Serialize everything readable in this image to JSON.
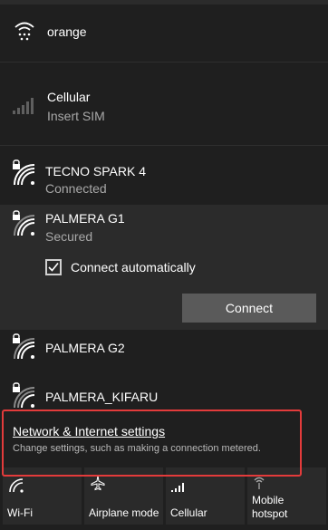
{
  "networks": {
    "top": {
      "name": "orange"
    },
    "cellular": {
      "name": "Cellular",
      "status": "Insert SIM"
    },
    "connected": {
      "name": "TECNO SPARK 4",
      "status": "Connected"
    },
    "selected": {
      "name": "PALMERA G1",
      "status": "Secured",
      "auto_label": "Connect automatically",
      "auto_checked": true,
      "connect_label": "Connect"
    },
    "others": [
      {
        "name": "PALMERA G2"
      },
      {
        "name": "PALMERA_KIFARU"
      }
    ]
  },
  "settings": {
    "title": "Network & Internet settings",
    "subtitle": "Change settings, such as making a connection metered."
  },
  "quick_actions": [
    {
      "label": "Wi-Fi",
      "icon": "wifi-icon"
    },
    {
      "label": "Airplane mode",
      "icon": "airplane-icon"
    },
    {
      "label": "Cellular",
      "icon": "cellular-icon"
    },
    {
      "label": "Mobile\nhotspot",
      "icon": "hotspot-icon"
    }
  ],
  "colors": {
    "background": "#1f1f1f",
    "selected_row": "#2b2b2b",
    "highlight_border": "#e33b3b",
    "button": "#5a5a5a"
  }
}
